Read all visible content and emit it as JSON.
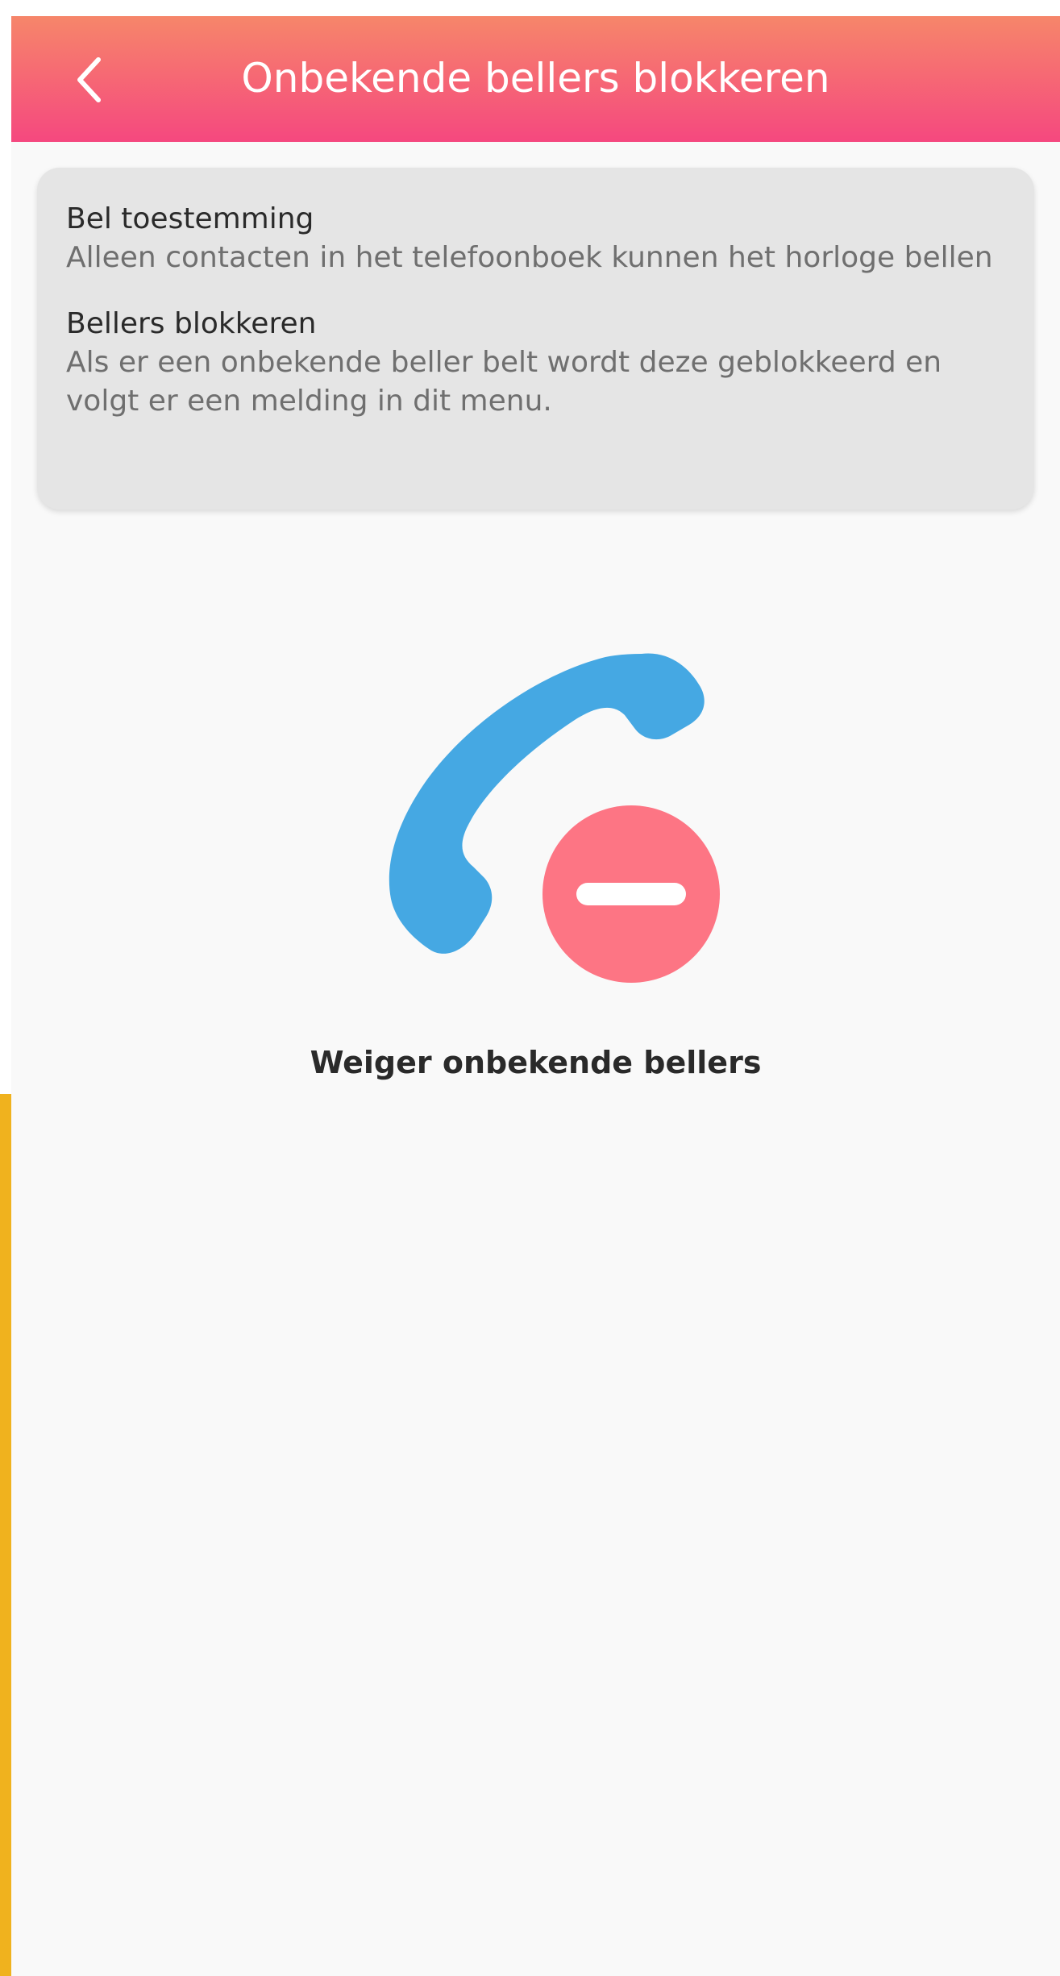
{
  "header": {
    "title": "Onbekende bellers blokkeren",
    "back_icon": "chevron-left-icon"
  },
  "info_card": {
    "items": [
      {
        "title": "Bel toestemming",
        "description": "Alleen contacten in het telefoonboek kunnen het horloge bellen"
      },
      {
        "title": "Bellers blokkeren",
        "description": "Als er een onbekende beller belt wordt deze geblokkeerd en volgt er een melding in dit menu."
      }
    ]
  },
  "illustration": {
    "phone_icon": "phone-handset-icon",
    "block_icon": "minus-circle-icon"
  },
  "caption": "Weiger onbekende bellers",
  "colors": {
    "header_gradient_top": "#f6866a",
    "header_gradient_bottom": "#f5487f",
    "phone_blue": "#45a8e3",
    "block_red": "#fd7584",
    "side_accent": "#f0b21e",
    "card_background": "#e5e5e5",
    "page_background": "#f9f9f9"
  }
}
